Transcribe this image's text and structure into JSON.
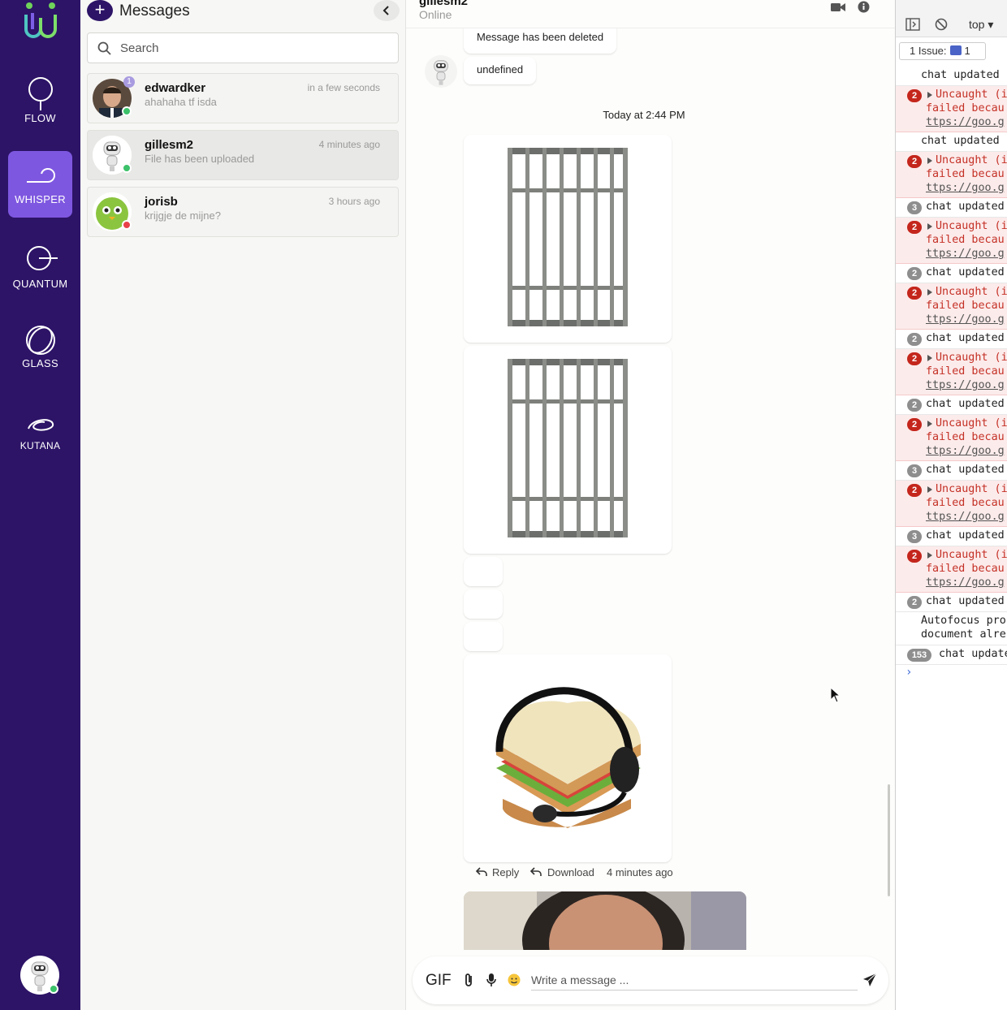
{
  "nav": {
    "items": [
      {
        "label": "FLOW"
      },
      {
        "label": "WHISPER"
      },
      {
        "label": "QUANTUM"
      },
      {
        "label": "GLASS"
      },
      {
        "label": "KUTANA"
      }
    ]
  },
  "messages_panel": {
    "title": "Messages",
    "search_placeholder": "Search",
    "chats": [
      {
        "name": "edwardker",
        "preview": "ahahaha tf isda",
        "time": "in a few seconds",
        "unread": "1",
        "status": "online"
      },
      {
        "name": "gillesm2",
        "preview": "File has been uploaded",
        "time": "4 minutes ago",
        "status": "online"
      },
      {
        "name": "jorisb",
        "preview": "krijgje de mijne?",
        "time": "3 hours ago",
        "status": "offline"
      }
    ]
  },
  "conversation": {
    "contact_name": "gillesm2",
    "contact_status": "Online",
    "messages": {
      "deleted": "Message has been deleted",
      "undefined_msg": "undefined"
    },
    "date_separator": "Today at 2:44 PM",
    "actions": {
      "reply": "Reply",
      "download": "Download",
      "time": "4 minutes ago"
    },
    "composer": {
      "gif_label": "GIF",
      "placeholder": "Write a message ..."
    }
  },
  "devtools": {
    "top_label": "top",
    "issues_label": "1 Issue:",
    "issues_count": "1",
    "logs": [
      {
        "type": "info",
        "count": "",
        "lines": [
          "chat updated"
        ]
      },
      {
        "type": "err",
        "count": "2",
        "lines": [
          "Uncaught (i",
          "failed becau",
          "ttps://goo.g"
        ]
      },
      {
        "type": "info",
        "count": "",
        "lines": [
          "chat updated"
        ]
      },
      {
        "type": "err",
        "count": "2",
        "lines": [
          "Uncaught (i",
          "failed becau",
          "ttps://goo.g"
        ]
      },
      {
        "type": "info",
        "count": "3",
        "lines": [
          "chat updated"
        ]
      },
      {
        "type": "err",
        "count": "2",
        "lines": [
          "Uncaught (i",
          "failed becau",
          "ttps://goo.g"
        ]
      },
      {
        "type": "info",
        "count": "2",
        "lines": [
          "chat updated"
        ]
      },
      {
        "type": "err",
        "count": "2",
        "lines": [
          "Uncaught (i",
          "failed becau",
          "ttps://goo.g"
        ]
      },
      {
        "type": "info",
        "count": "2",
        "lines": [
          "chat updated"
        ]
      },
      {
        "type": "err",
        "count": "2",
        "lines": [
          "Uncaught (i",
          "failed becau",
          "ttps://goo.g"
        ]
      },
      {
        "type": "info",
        "count": "2",
        "lines": [
          "chat updated"
        ]
      },
      {
        "type": "err",
        "count": "2",
        "lines": [
          "Uncaught (i",
          "failed becau",
          "ttps://goo.g"
        ]
      },
      {
        "type": "info",
        "count": "3",
        "lines": [
          "chat updated"
        ]
      },
      {
        "type": "err",
        "count": "2",
        "lines": [
          "Uncaught (i",
          "failed becau",
          "ttps://goo.g"
        ]
      },
      {
        "type": "info",
        "count": "3",
        "lines": [
          "chat updated"
        ]
      },
      {
        "type": "err",
        "count": "2",
        "lines": [
          "Uncaught (i",
          "failed becau",
          "ttps://goo.g"
        ]
      },
      {
        "type": "info",
        "count": "2",
        "lines": [
          "chat updated"
        ]
      },
      {
        "type": "info",
        "count": "",
        "lines": [
          "Autofocus pro",
          "document alre"
        ]
      },
      {
        "type": "info",
        "count": "153",
        "lines": [
          "chat update"
        ]
      }
    ]
  },
  "colors": {
    "nav_bg": "#2d1467",
    "nav_active": "#7e57e0",
    "online": "#3cc26a",
    "offline": "#e8414a"
  }
}
